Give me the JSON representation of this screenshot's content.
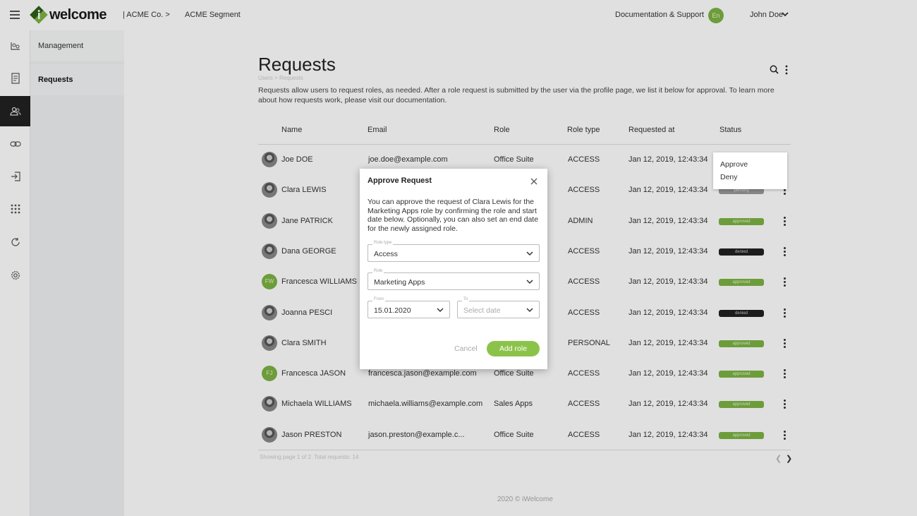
{
  "header": {
    "logo_text": "welcome",
    "breadcrumb_org": "| ACME Co.  >",
    "breadcrumb_segment": "ACME Segment",
    "docs_link": "Documentation & Support",
    "avatar_initials": "En",
    "user_name": "John Doe"
  },
  "rail": {
    "icons": [
      "segment-icon",
      "document-icon",
      "users-icon",
      "link-icon",
      "login-icon",
      "apps-grid-icon",
      "refresh-icon",
      "settings-icon"
    ],
    "active_index": 2
  },
  "subnav": {
    "items": [
      {
        "label": "Management"
      },
      {
        "label": "Requests"
      }
    ],
    "active_index": 1
  },
  "page": {
    "title": "Requests",
    "breadcrumb": "Users > Requests",
    "intro": "Requests allow users to request roles, as needed. After a role request is submitted by the user via the profile page, we list  it below for approval. To learn more about how requests work, please visit our documentation."
  },
  "table": {
    "columns": [
      "Name",
      "Email",
      "Role",
      "Role type",
      "Requested at",
      "Status"
    ],
    "rows": [
      {
        "name": "Joe DOE",
        "email": "joe.doe@example.com",
        "role": "Office Suite",
        "role_type": "ACCESS",
        "requested_at": "Jan 12, 2019, 12:43:34",
        "status": "",
        "avatar": "photo"
      },
      {
        "name": "Clara LEWIS",
        "email": "",
        "role": "",
        "role_type": "ACCESS",
        "requested_at": "Jan 12, 2019, 12:43:34",
        "status": "pending",
        "avatar": "photo"
      },
      {
        "name": "Jane PATRICK",
        "email": "",
        "role": "",
        "role_type": "ADMIN",
        "requested_at": "Jan 12, 2019, 12:43:34",
        "status": "approved",
        "avatar": "photo"
      },
      {
        "name": "Dana GEORGE",
        "email": "",
        "role": "",
        "role_type": "ACCESS",
        "requested_at": "Jan 12, 2019, 12:43:34",
        "status": "denied",
        "avatar": "photo"
      },
      {
        "name": "Francesca WILLIAMS",
        "email": "",
        "role": "",
        "role_type": "ACCESS",
        "requested_at": "Jan 12, 2019, 12:43:34",
        "status": "approved",
        "avatar": "FW"
      },
      {
        "name": "Joanna PESCI",
        "email": "",
        "role": "",
        "role_type": "ACCESS",
        "requested_at": "Jan 12, 2019, 12:43:34",
        "status": "denied",
        "avatar": "photo"
      },
      {
        "name": "Clara SMITH",
        "email": "",
        "role": "",
        "role_type": "PERSONAL",
        "requested_at": "Jan 12, 2019, 12:43:34",
        "status": "approved",
        "avatar": "photo"
      },
      {
        "name": "Francesca JASON",
        "email": "francesca.jason@example.com",
        "role": "Office Suite",
        "role_type": "ACCESS",
        "requested_at": "Jan 12, 2019, 12:43:34",
        "status": "approved",
        "avatar": "FJ"
      },
      {
        "name": "Michaela WILLIAMS",
        "email": "michaela.williams@example.com",
        "role": "Sales Apps",
        "role_type": "ACCESS",
        "requested_at": "Jan 12, 2019, 12:43:34",
        "status": "approved",
        "avatar": "photo"
      },
      {
        "name": "Jason PRESTON",
        "email": "jason.preston@example.c...",
        "role": "Office Suite",
        "role_type": "ACCESS",
        "requested_at": "Jan 12, 2019, 12:43:34",
        "status": "approved",
        "avatar": "photo"
      }
    ],
    "footer": "Showing page 1 of 2. Total requests: 14"
  },
  "row_menu": {
    "items": [
      "Approve",
      "Deny"
    ]
  },
  "modal": {
    "title": "Approve Request",
    "text": "You can approve the request of Clara Lewis for the Marketing Apps role by confirming the role and start date below. Optionally, you can also set an end date for the newly assigned role.",
    "role_type_label": "Role type",
    "role_type_value": "Access",
    "role_label": "Role",
    "role_value": "Marketing Apps",
    "from_label": "From",
    "from_value": "15.01.2020",
    "to_label": "To",
    "to_placeholder": "Select date",
    "cancel_label": "Cancel",
    "add_label": "Add role"
  },
  "footer": {
    "copyright": "2020 © iWelcome"
  },
  "colors": {
    "accent": "#7cb342",
    "denied": "#222222"
  }
}
